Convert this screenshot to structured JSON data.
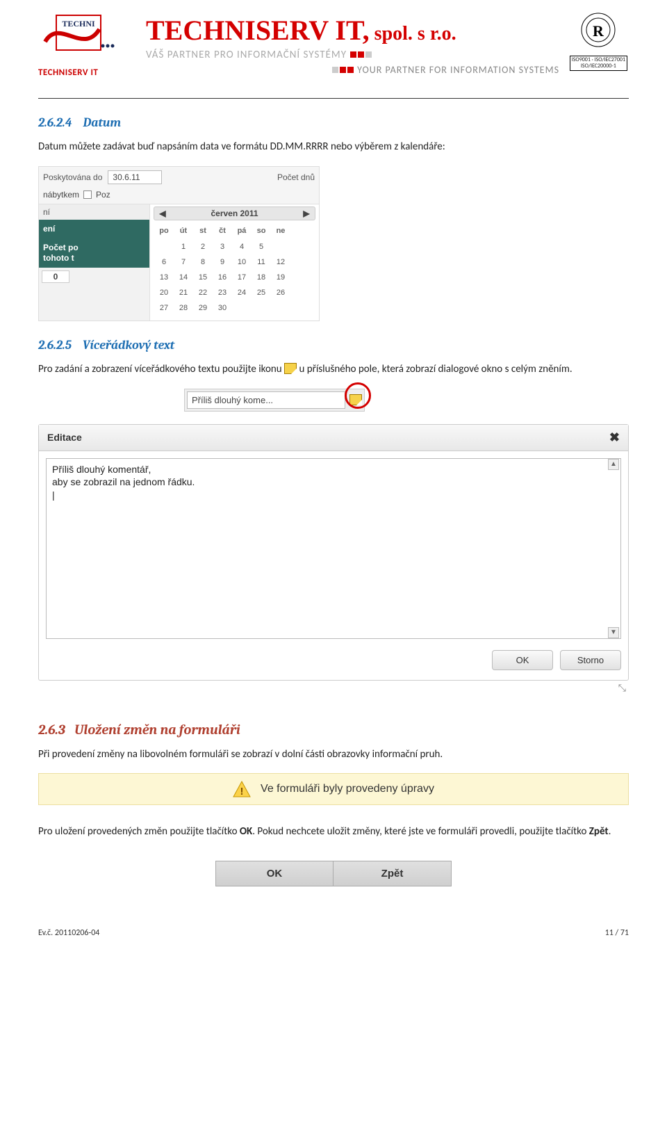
{
  "header": {
    "company_name": "TECHNISERV IT,",
    "company_suffix": " spol. s r.o.",
    "tagline_cs_before": "VÁŠ PARTNER PRO INFORMAČNÍ SYSTÉMY",
    "tagline_en_after": "YOUR PARTNER FOR INFORMATION SYSTEMS",
    "logo_caption": "TECHNISERV IT",
    "cert_line1": "ISO9001 · ISO/IEC27001",
    "cert_line2": "ISO/IEC20000-1"
  },
  "sections": {
    "s2624_num": "2.6.2.4",
    "s2624_title": "Datum",
    "s2624_body": "Datum můžete zadávat buď napsáním data ve formátu DD.MM.RRRR nebo výběrem  z kalendáře:",
    "s2625_num": "2.6.2.5",
    "s2625_title": "Víceřádkový text",
    "s2625_body_a": "Pro zadání a zobrazení víceřádkového textu použijte ikonu ",
    "s2625_body_b": " u příslušného pole, která zobrazí dialogové okno s celým zněním.",
    "s263_num": "2.6.3",
    "s263_title": "Uložení změn na formuláři",
    "s263_body": "Při provedení změny na libovolném formuláři se zobrazí v dolní části obrazovky informační pruh.",
    "save_body_a": "Pro uložení provedených změn použijte tlačítko ",
    "save_ok": "OK",
    "save_body_b": ". Pokud nechcete uložit změny, které jste ve formuláři provedli, použijte tlačítko ",
    "save_back": "Zpět",
    "save_body_c": "."
  },
  "calendar": {
    "label_do": "Poskytována do",
    "date_value": "30.6.11",
    "label_dnu": "Počet dnů",
    "label_nabytkem": "nábytkem",
    "label_poz": "Poz",
    "sidebar_plain": "ní",
    "sidebar_dark1": "ení",
    "sidebar_dark2_l1": "Počet po",
    "sidebar_dark2_l2": "tohoto t",
    "sidebar_zero": "0",
    "nav_prev": "◀",
    "month_label": "červen 2011",
    "nav_next": "▶",
    "dow": [
      "po",
      "út",
      "st",
      "čt",
      "pá",
      "so",
      "ne"
    ],
    "grid": [
      [
        "",
        "",
        "",
        "1",
        "2",
        "3",
        "4",
        "5"
      ],
      [
        "6",
        "7",
        "8",
        "9",
        "10",
        "11",
        "12"
      ],
      [
        "13",
        "14",
        "15",
        "16",
        "17",
        "18",
        "19"
      ],
      [
        "20",
        "21",
        "22",
        "23",
        "24",
        "25",
        "26"
      ],
      [
        "27",
        "28",
        "29",
        "30",
        "",
        "",
        ""
      ]
    ]
  },
  "inlinefield": {
    "value": "Příliš dlouhý kome..."
  },
  "editace": {
    "title": "Editace",
    "close": "✖",
    "text": "Příliš dlouhý komentář,\naby se zobrazil na jednom řádku.\n|",
    "ok": "OK",
    "storno": "Storno",
    "grip": "⤡"
  },
  "warning": {
    "text": "Ve formuláři byly provedeny úpravy"
  },
  "okzpet": {
    "ok": "OK",
    "zpet": "Zpět"
  },
  "footer": {
    "left": "Ev.č. 20110206-04",
    "right": "11 / 71"
  }
}
